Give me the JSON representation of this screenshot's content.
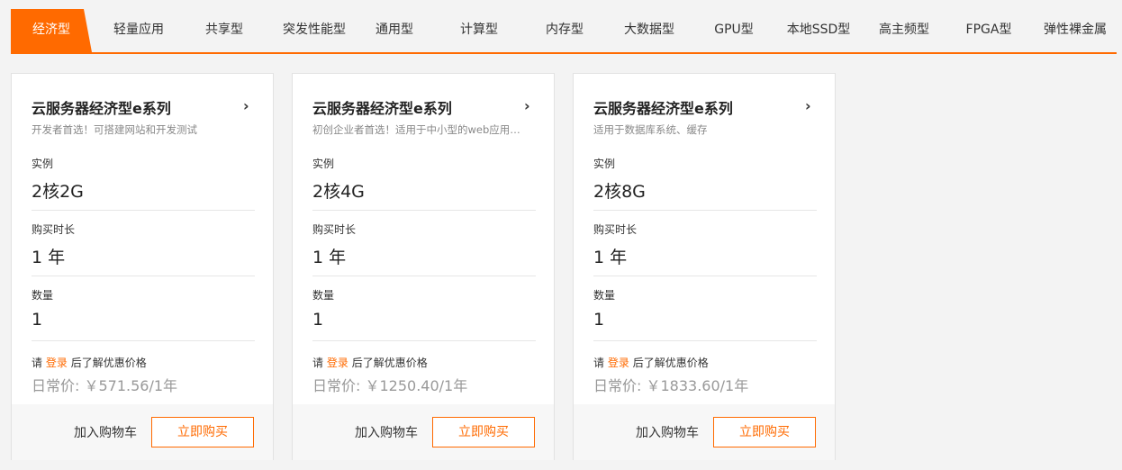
{
  "tabs": [
    {
      "label": "经济型",
      "active": true
    },
    {
      "label": "轻量应用",
      "active": false
    },
    {
      "label": "共享型",
      "active": false
    },
    {
      "label": "突发性能型",
      "active": false
    },
    {
      "label": "通用型",
      "active": false
    },
    {
      "label": "计算型",
      "active": false
    },
    {
      "label": "内存型",
      "active": false
    },
    {
      "label": "大数据型",
      "active": false
    },
    {
      "label": "GPU型",
      "active": false
    },
    {
      "label": "本地SSD型",
      "active": false
    },
    {
      "label": "高主频型",
      "active": false
    },
    {
      "label": "FPGA型",
      "active": false
    },
    {
      "label": "弹性裸金属",
      "active": false
    }
  ],
  "accent_color": "#ff6a00",
  "icons": {
    "chevron": "chevron-right-icon"
  },
  "cards": [
    {
      "title": "云服务器经济型e系列",
      "chevron": "›",
      "desc": "开发者首选！可搭建网站和开发测试",
      "instance_label": "实例",
      "instance_value": "2核2G",
      "duration_label": "购买时长",
      "duration_value": "1 年",
      "quantity_label": "数量",
      "quantity_value": "1",
      "login_prefix": "请",
      "login_link": "登录",
      "login_suffix": "后了解优惠价格",
      "price": "日常价: ￥571.56/1年",
      "cart_label": "加入购物车",
      "buy_label": "立即购买"
    },
    {
      "title": "云服务器经济型e系列",
      "chevron": "›",
      "desc": "初创企业者首选！适用于中小型的web应用…",
      "instance_label": "实例",
      "instance_value": "2核4G",
      "duration_label": "购买时长",
      "duration_value": "1 年",
      "quantity_label": "数量",
      "quantity_value": "1",
      "login_prefix": "请",
      "login_link": "登录",
      "login_suffix": "后了解优惠价格",
      "price": "日常价: ￥1250.40/1年",
      "cart_label": "加入购物车",
      "buy_label": "立即购买"
    },
    {
      "title": "云服务器经济型e系列",
      "chevron": "›",
      "desc": "适用于数据库系统、缓存",
      "instance_label": "实例",
      "instance_value": "2核8G",
      "duration_label": "购买时长",
      "duration_value": "1 年",
      "quantity_label": "数量",
      "quantity_value": "1",
      "login_prefix": "请",
      "login_link": "登录",
      "login_suffix": "后了解优惠价格",
      "price": "日常价: ￥1833.60/1年",
      "cart_label": "加入购物车",
      "buy_label": "立即购买"
    }
  ]
}
